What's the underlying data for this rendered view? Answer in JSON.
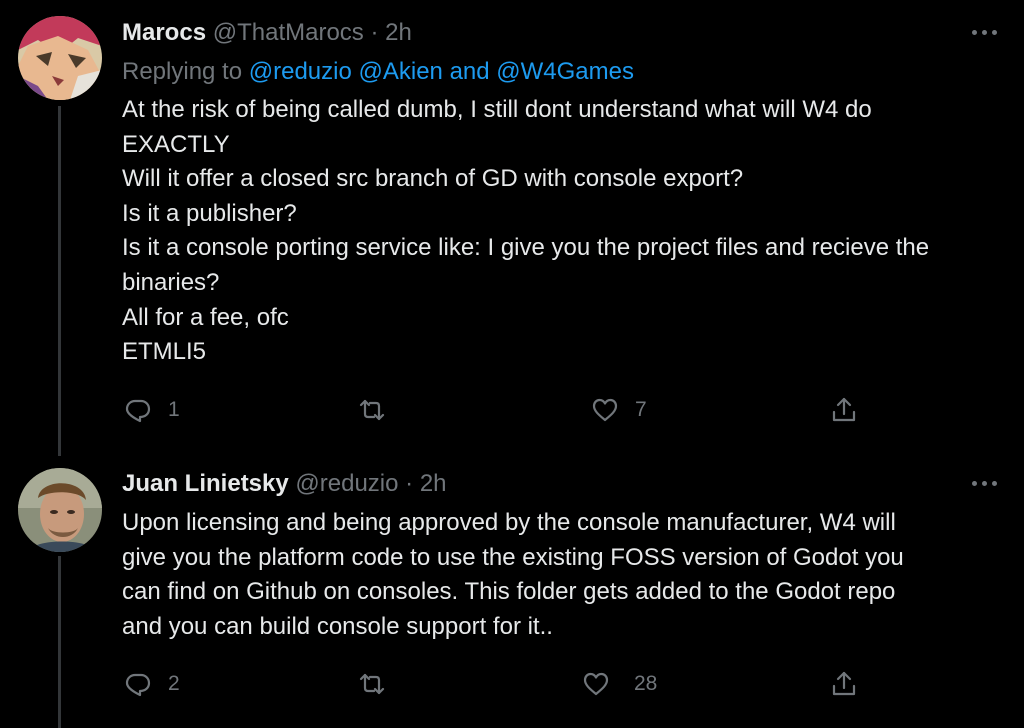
{
  "tweets": [
    {
      "name": "Marocs",
      "handle": "@ThatMarocs",
      "separator": "·",
      "time": "2h",
      "replying_prefix": "Replying to",
      "replying_mentions": "@reduzio @Akien and @W4Games",
      "lines": [
        "At the risk of being called dumb, I still dont understand what will W4 do",
        "EXACTLY",
        "Will it offer a closed src branch of GD with console export?",
        "Is it a publisher?",
        "Is it a console porting service like: I give you the project files and recieve the",
        "binaries?",
        "All for a fee, ofc",
        "ETMLI5"
      ],
      "replies": "1",
      "retweets": "",
      "likes": "7"
    },
    {
      "name": "Juan Linietsky",
      "handle": "@reduzio",
      "separator": "·",
      "time": "2h",
      "lines": [
        "Upon licensing and being approved by the console manufacturer, W4 will",
        "give you the platform code to use the existing FOSS version of Godot you",
        "can find on Github on consoles. This folder gets added to the Godot repo",
        "and you can build console support for it.."
      ],
      "replies": "2",
      "retweets": "",
      "likes": "28"
    }
  ],
  "icons": [
    "reply-icon",
    "retweet-icon",
    "like-icon",
    "share-icon",
    "more-icon"
  ],
  "colors": {
    "background": "#000000",
    "text": "#e7e9ea",
    "muted": "#71767b",
    "link": "#1d9bf0"
  }
}
